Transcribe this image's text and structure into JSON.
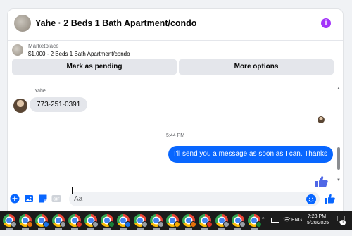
{
  "header": {
    "title": "Yahe · 2 Beds 1 Bath Apartment/condo",
    "info_icon": "info-icon"
  },
  "listing": {
    "source": "Marketplace",
    "price_title": "$1,000 - 2 Beds 1 Bath Apartment/condo",
    "buttons": {
      "mark_pending": "Mark as pending",
      "more_options": "More options"
    }
  },
  "messages": {
    "incoming_sender": "Yahe",
    "incoming_text": "773-251-0391",
    "timestamp": "5:44 PM",
    "outgoing_text": "I'll send you a message as soon as I can. Thanks"
  },
  "composer": {
    "placeholder": "Aa"
  },
  "taskbar": {
    "app_count": 16,
    "profile_colors": [
      "#9aa0a6",
      "#e8710a",
      "#1a73e8",
      "#9aa0a6",
      "#d93025",
      "#9aa0a6",
      "#188038",
      "#1a73e8",
      "#9aa0a6",
      "#9aa0a6",
      "#f9ab00",
      "#e8710a",
      "#d93025",
      "#9aa0a6",
      "#9aa0a6",
      "#188038"
    ],
    "language": "ENG",
    "time": "7:23 PM",
    "date": "5/20/2025",
    "notifications": "1"
  },
  "colors": {
    "messenger_blue": "#0866ff",
    "info_purple": "#a334fa",
    "bubble_grey": "#e4e6eb",
    "taskbar": "#1c1c1c"
  }
}
